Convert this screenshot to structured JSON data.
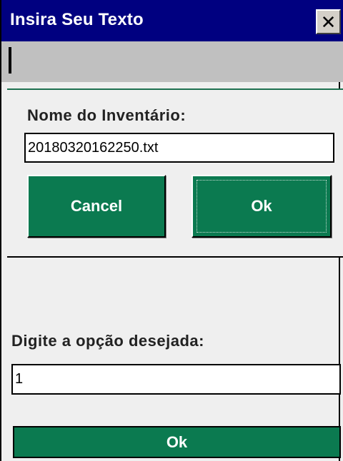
{
  "window": {
    "title": "Insira Seu Texto",
    "close_glyph": "✕"
  },
  "dialog": {
    "label": "Nome do Inventário:",
    "filename_value": "20180320162250.txt",
    "cancel_label": "Cancel",
    "ok_label": "Ok"
  },
  "main": {
    "prompt_label": "Digite a opção desejada:",
    "option_value": "1",
    "ok_label": "Ok"
  },
  "colors": {
    "titlebar": "#000080",
    "button_green": "#0b7a50",
    "background": "#efefef"
  }
}
